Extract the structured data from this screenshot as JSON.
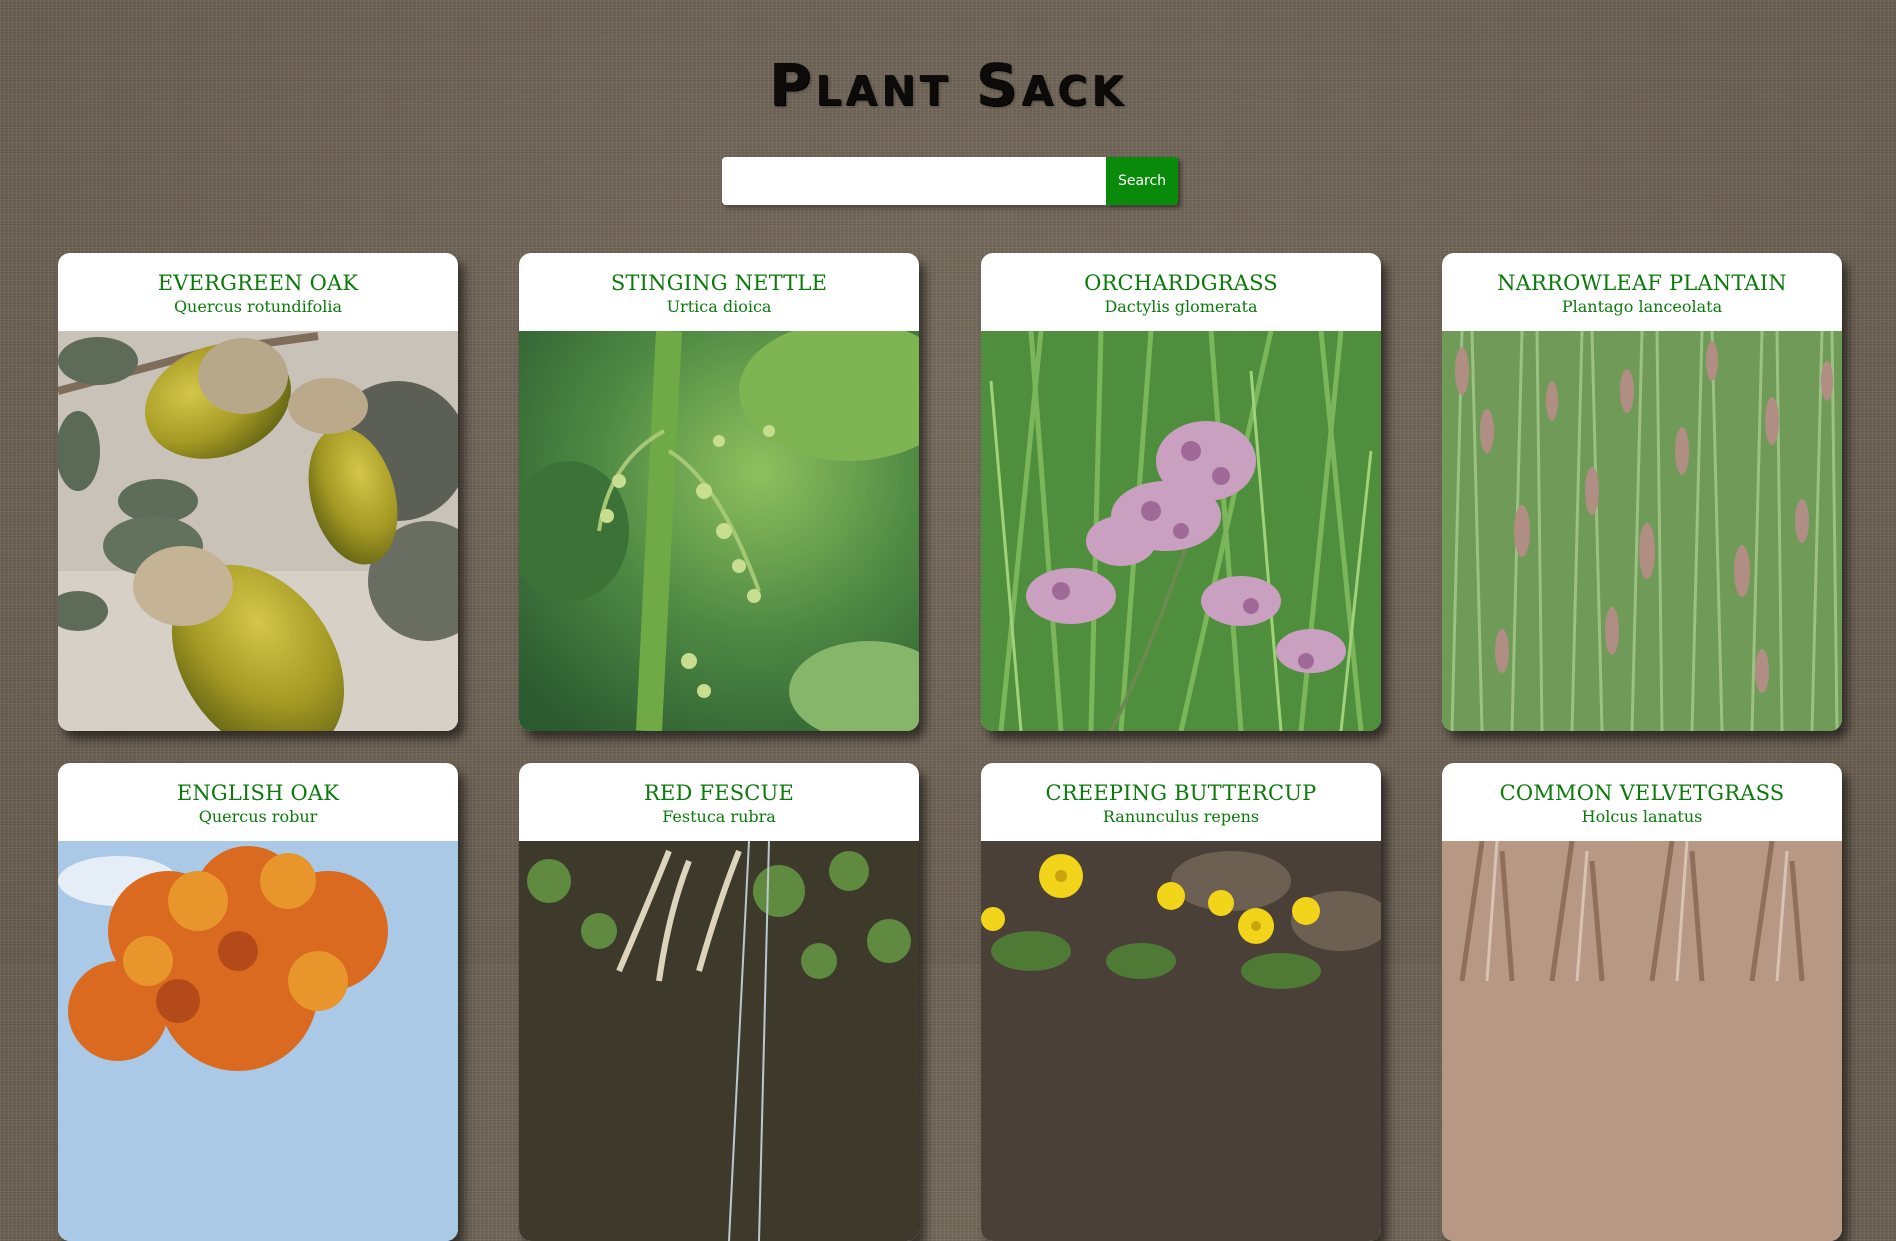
{
  "site": {
    "title": "Plant Sack"
  },
  "search": {
    "value": "",
    "placeholder": "",
    "button_label": "Search"
  },
  "plants": [
    {
      "common_name": "EVERGREEN OAK",
      "scientific_name": "Quercus rotundifolia",
      "image": "acorns-photo"
    },
    {
      "common_name": "STINGING NETTLE",
      "scientific_name": "Urtica dioica",
      "image": "nettle-flowers-photo"
    },
    {
      "common_name": "ORCHARDGRASS",
      "scientific_name": "Dactylis glomerata",
      "image": "grass-panicle-photo"
    },
    {
      "common_name": "NARROWLEAF PLANTAIN",
      "scientific_name": "Plantago lanceolata",
      "image": "plantain-spikes-photo"
    },
    {
      "common_name": "ENGLISH OAK",
      "scientific_name": "Quercus robur",
      "image": "autumn-oak-photo"
    },
    {
      "common_name": "RED FESCUE",
      "scientific_name": "Festuca rubra",
      "image": "fescue-photo"
    },
    {
      "common_name": "CREEPING BUTTERCUP",
      "scientific_name": "Ranunculus repens",
      "image": "buttercup-photo"
    },
    {
      "common_name": "COMMON VELVETGRASS",
      "scientific_name": "Holcus lanatus",
      "image": "velvetgrass-photo"
    }
  ],
  "colors": {
    "accent_green": "#0a8a0a",
    "title_green": "#0a7a0a",
    "background": "#6e6253"
  }
}
